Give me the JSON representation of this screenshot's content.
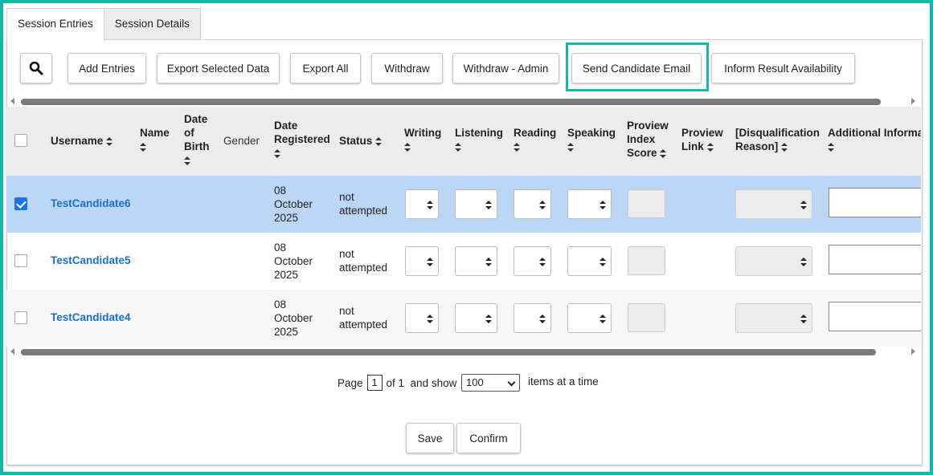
{
  "tabs": [
    {
      "label": "Session Entries",
      "active": true
    },
    {
      "label": "Session Details",
      "active": false
    }
  ],
  "toolbar": {
    "search_icon": "search-icon",
    "buttons": [
      {
        "label": "Add Entries"
      },
      {
        "label": "Export Selected Data"
      },
      {
        "label": "Export All"
      },
      {
        "label": "Withdraw"
      },
      {
        "label": "Withdraw - Admin"
      },
      {
        "label": "Send Candidate Email",
        "highlighted": true
      },
      {
        "label": "Inform Result Availability"
      }
    ]
  },
  "accent_color": "#14b8a6",
  "link_color": "#1a6fd1",
  "selected_row_color": "#bcd6f5",
  "table": {
    "headers": {
      "username": "Username",
      "name": "Name",
      "dob_1": "Date",
      "dob_2": "of",
      "dob_3": "Birth",
      "gender": "Gender",
      "date_reg_1": "Date",
      "date_reg_2": "Registered",
      "status": "Status",
      "writing": "Writing",
      "listening": "Listening",
      "reading": "Reading",
      "speaking": "Speaking",
      "proview_1": "Proview",
      "proview_2": "Index",
      "proview_3": "Score",
      "plink_1": "Proview",
      "plink_2": "Link",
      "disq_1": "[Disqualification",
      "disq_2": "Reason]",
      "additional": "Additional Information"
    },
    "rows": [
      {
        "username": "TestCandidate6",
        "date_1": "08",
        "date_2": "October",
        "date_3": "2025",
        "status_1": "not",
        "status_2": "attempted",
        "checked": true
      },
      {
        "username": "TestCandidate5",
        "date_1": "08",
        "date_2": "October",
        "date_3": "2025",
        "status_1": "not",
        "status_2": "attempted",
        "checked": false
      },
      {
        "username": "TestCandidate4",
        "date_1": "08",
        "date_2": "October",
        "date_3": "2025",
        "status_1": "not",
        "status_2": "attempted",
        "checked": false
      }
    ]
  },
  "pagination": {
    "page_label": "Page",
    "page_value": "1",
    "of_label": "of 1  and show",
    "per_page": "100",
    "items_label": "items at a time"
  },
  "footer": {
    "save_label": "Save",
    "confirm_label": "Confirm"
  }
}
